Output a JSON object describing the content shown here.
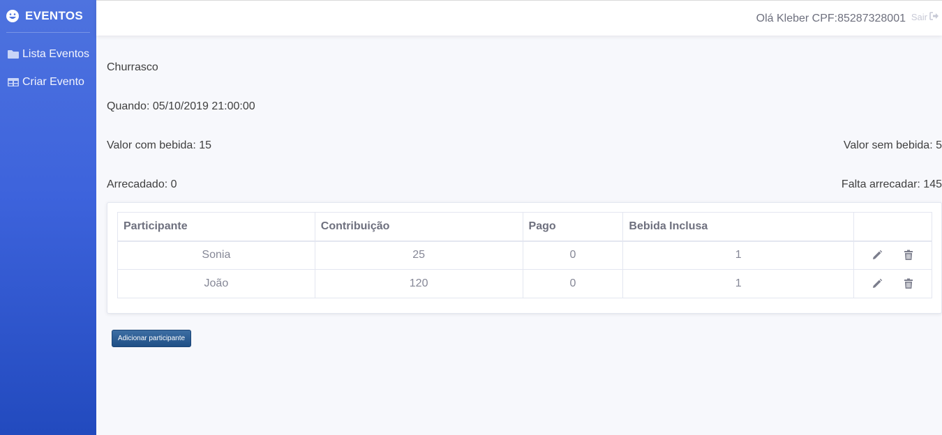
{
  "sidebar": {
    "brand": "EVENTOS",
    "brand_icon": "laugh-icon",
    "items": [
      {
        "label": "Lista Eventos",
        "icon": "folder-icon"
      },
      {
        "label": "Criar Evento",
        "icon": "table-icon"
      }
    ]
  },
  "topbar": {
    "greeting": "Olá Kleber CPF:85287328001",
    "logout_label": "Sair",
    "logout_icon": "sign-out-icon"
  },
  "event": {
    "name": "Churrasco",
    "when": "Quando: 05/10/2019 21:00:00",
    "valor_com_bebida": "Valor com bebida: 15",
    "valor_sem_bebida": "Valor sem bebida: 5",
    "arrecadado": "Arrecadado: 0",
    "falta_arrecadar": "Falta arrecadar: 145"
  },
  "table": {
    "headers": [
      "Participante",
      "Contribuição",
      "Pago",
      "Bebida Inclusa",
      ""
    ],
    "rows": [
      {
        "participante": "Sonia",
        "contribuicao": "25",
        "pago": "0",
        "bebida": "1"
      },
      {
        "participante": "João",
        "contribuicao": "120",
        "pago": "0",
        "bebida": "1"
      }
    ]
  },
  "add_button_label": "Adicionar participante",
  "colors": {
    "sidebar_top": "#4e73df",
    "sidebar_bottom": "#224abe",
    "button": "#2a5a91"
  }
}
